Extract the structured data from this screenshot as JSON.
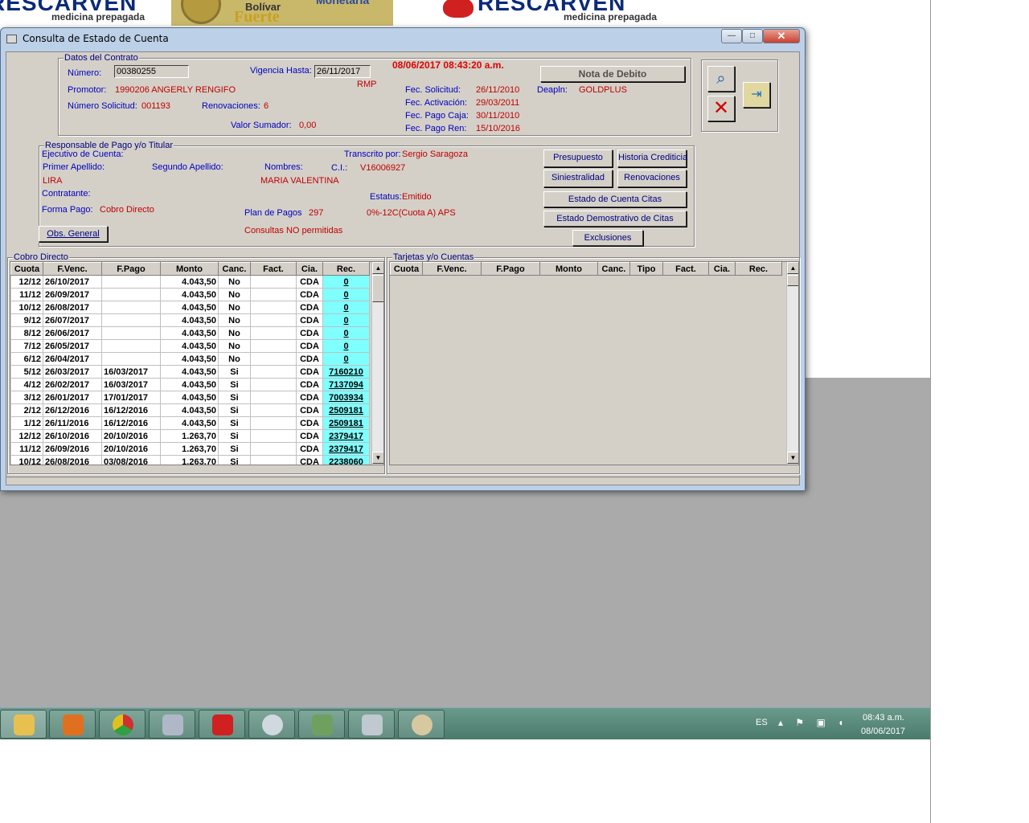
{
  "wallpaper": {
    "logo_left": "RESCARVEN",
    "logo_left_sub": "medicina prepagada",
    "bolivar_line1": "Bolívar",
    "bolivar_line2": "Fuerte",
    "bolivar_line3": "Monetaria",
    "logo_right": "RESCARVEN",
    "logo_right_sub": "medicina prepagada"
  },
  "window": {
    "title": "Consulta de Estado de Cuenta",
    "minimize": "—",
    "maximize": "□",
    "close": "✕"
  },
  "contrato": {
    "group_title": "Datos del Contrato",
    "numero_label": "Número:",
    "numero_value": "00380255",
    "vigencia_label": "Vigencia Hasta:",
    "vigencia_value": "26/11/2017",
    "timestamp": "08/06/2017 08:43:20 a.m.",
    "nota_debito": "Nota de Debito",
    "promotor_label": "Promotor:",
    "promotor_value": "1990206  ANGERLY RENGIFO",
    "rmp": "RMP",
    "num_solicitud_label": "Número Solicitud:",
    "num_solicitud_value": "001193",
    "renovaciones_label": "Renovaciones:",
    "renovaciones_value": "6",
    "valor_sumador_label": "Valor Sumador:",
    "valor_sumador_value": "0,00",
    "fec_solicitud_label": "Fec. Solicitud:",
    "fec_solicitud_value": "26/11/2010",
    "fec_activacion_label": "Fec. Activación:",
    "fec_activacion_value": "29/03/2011",
    "fec_pago_caja_label": "Fec. Pago Caja:",
    "fec_pago_caja_value": "30/11/2010",
    "fec_pago_ren_label": "Fec. Pago Ren:",
    "fec_pago_ren_value": "15/10/2016",
    "deapln_label": "Deapln:",
    "deapln_value": "GOLDPLUS"
  },
  "responsable": {
    "group_title": "Responsable de Pago y/o Titular",
    "ejecutivo_label": "Ejecutivo de Cuenta:",
    "transcrito_label": "Transcrito por:",
    "transcrito_value": "Sergio Saragoza",
    "primer_apellido_label": "Primer Apellido:",
    "segundo_apellido_label": "Segundo Apellido:",
    "nombres_label": "Nombres:",
    "ci_label": "C.I.:",
    "ci_value": "V16006927",
    "primer_apellido_value": "LIRA",
    "nombres_value": "MARIA VALENTINA",
    "contratante_label": "Contratante:",
    "estatus_label": "Estatus:",
    "estatus_value": "Emitido",
    "forma_pago_label": "Forma Pago:",
    "forma_pago_value": "Cobro Directo",
    "plan_pagos_label": "Plan de Pagos",
    "plan_pagos_value": "297",
    "plan_pagos_desc": "0%-12C(Cuota A) APS",
    "obs_general": "Obs. General",
    "consultas": "Consultas NO permitidas"
  },
  "buttons": {
    "presupuesto": "Presupuesto",
    "historia": "Historia Crediticia",
    "siniestralidad": "Siniestralidad",
    "renovaciones": "Renovaciones",
    "estado_cuenta_citas": "Estado de Cuenta Citas",
    "estado_demostrativo": "Estado Demostrativo de Citas",
    "exclusiones": "Exclusiones"
  },
  "cobro": {
    "group_title": "Cobro Directo",
    "columns": [
      "Cuota",
      "F.Venc.",
      "F.Pago",
      "Monto",
      "Canc.",
      "Fact.",
      "Cia.",
      "Rec."
    ],
    "rows": [
      [
        "12/12",
        "26/10/2017",
        "",
        "4.043,50",
        "No",
        "",
        "CDA",
        "0"
      ],
      [
        "11/12",
        "26/09/2017",
        "",
        "4.043,50",
        "No",
        "",
        "CDA",
        "0"
      ],
      [
        "10/12",
        "26/08/2017",
        "",
        "4.043,50",
        "No",
        "",
        "CDA",
        "0"
      ],
      [
        "9/12",
        "26/07/2017",
        "",
        "4.043,50",
        "No",
        "",
        "CDA",
        "0"
      ],
      [
        "8/12",
        "26/06/2017",
        "",
        "4.043,50",
        "No",
        "",
        "CDA",
        "0"
      ],
      [
        "7/12",
        "26/05/2017",
        "",
        "4.043,50",
        "No",
        "",
        "CDA",
        "0"
      ],
      [
        "6/12",
        "26/04/2017",
        "",
        "4.043,50",
        "No",
        "",
        "CDA",
        "0"
      ],
      [
        "5/12",
        "26/03/2017",
        "16/03/2017",
        "4.043,50",
        "Si",
        "",
        "CDA",
        "7160210"
      ],
      [
        "4/12",
        "26/02/2017",
        "16/03/2017",
        "4.043,50",
        "Si",
        "",
        "CDA",
        "7137094"
      ],
      [
        "3/12",
        "26/01/2017",
        "17/01/2017",
        "4.043,50",
        "Si",
        "",
        "CDA",
        "7003934"
      ],
      [
        "2/12",
        "26/12/2016",
        "16/12/2016",
        "4.043,50",
        "Si",
        "",
        "CDA",
        "2509181"
      ],
      [
        "1/12",
        "26/11/2016",
        "16/12/2016",
        "4.043,50",
        "Si",
        "",
        "CDA",
        "2509181"
      ],
      [
        "12/12",
        "26/10/2016",
        "20/10/2016",
        "1.263,70",
        "Si",
        "",
        "CDA",
        "2379417"
      ],
      [
        "11/12",
        "26/09/2016",
        "20/10/2016",
        "1.263,70",
        "Si",
        "",
        "CDA",
        "2379417"
      ],
      [
        "10/12",
        "26/08/2016",
        "03/08/2016",
        "1.263,70",
        "Si",
        "",
        "CDA",
        "2238060"
      ]
    ]
  },
  "tarjetas": {
    "group_title": "Tarjetas y/o Cuentas",
    "columns": [
      "Cuota",
      "F.Venc.",
      "F.Pago",
      "Monto",
      "Canc.",
      "Tipo",
      "Fact.",
      "Cia.",
      "Rec."
    ]
  },
  "taskbar": {
    "lang": "ES",
    "tray": "▴ ⚑ ▣ ◖",
    "time": "08:43 a.m.",
    "date": "08/06/2017",
    "apps": [
      "explorer-icon",
      "media-player-icon",
      "chrome-icon",
      "tools-icon",
      "rescarven-icon",
      "globe-icon",
      "network-app-icon",
      "calculator-icon",
      "paint-icon"
    ]
  }
}
